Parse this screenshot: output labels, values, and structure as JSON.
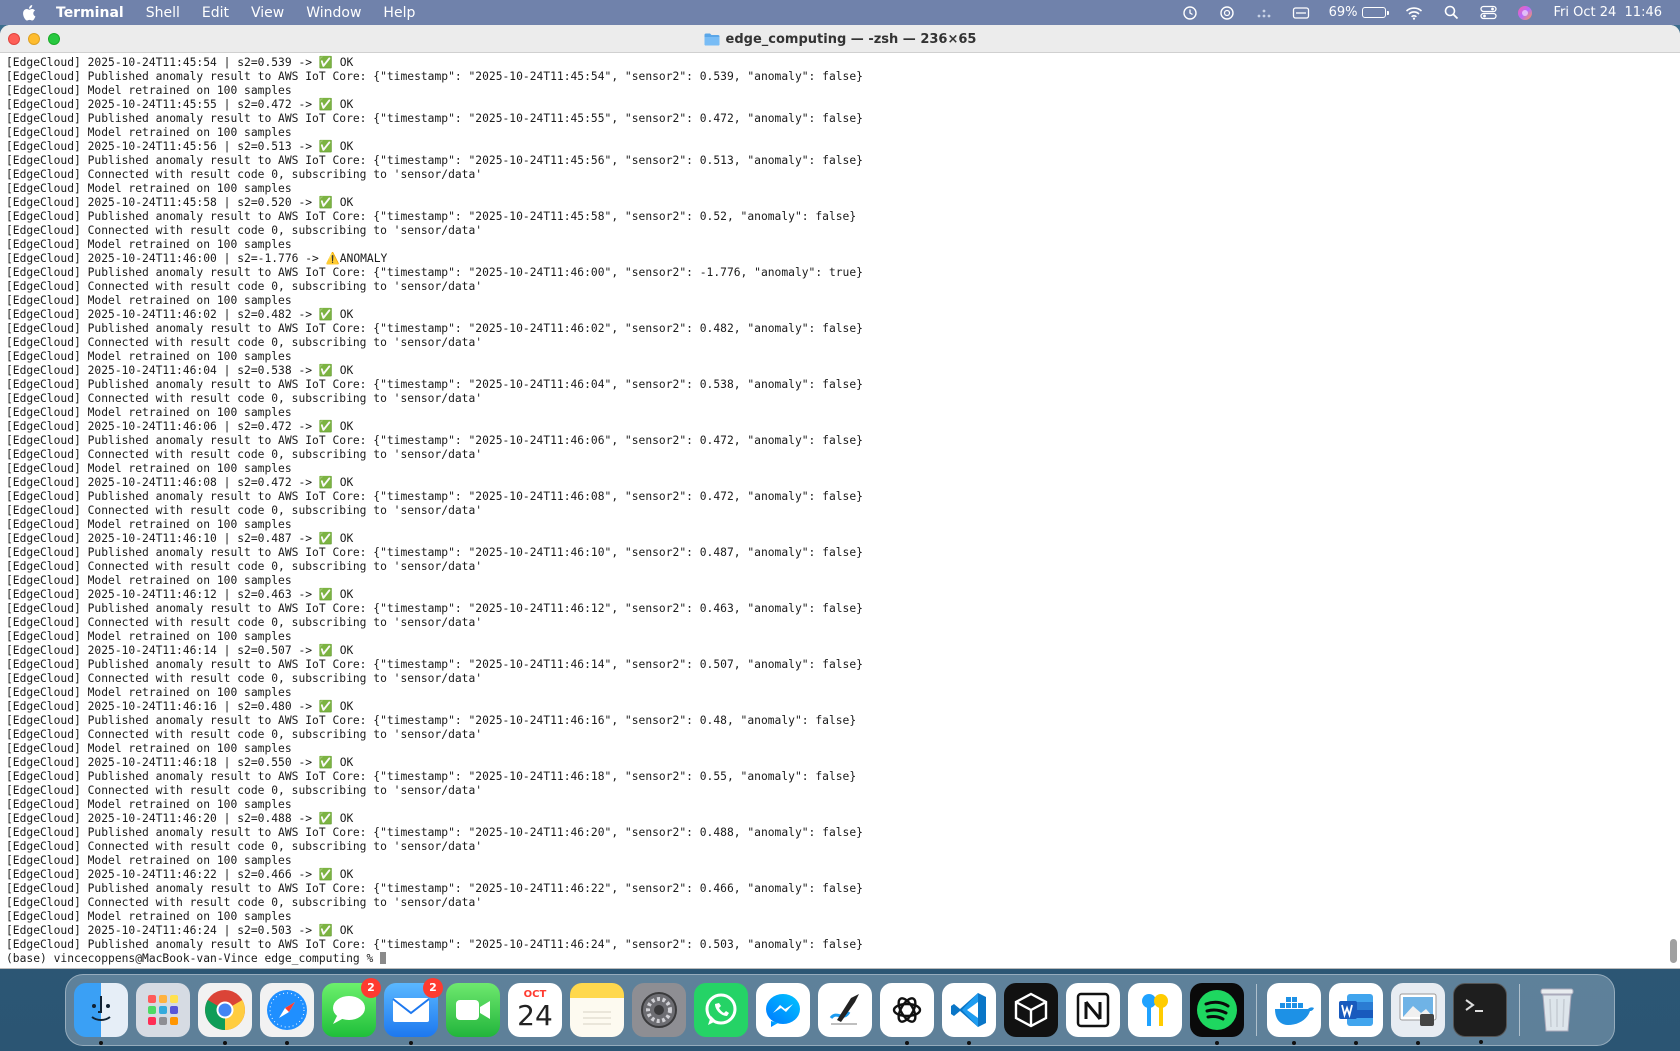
{
  "menubar": {
    "app_name": "Terminal",
    "items": [
      "Shell",
      "Edit",
      "View",
      "Window",
      "Help"
    ],
    "battery_percent": "69%",
    "battery_level": 0.69,
    "datetime": "Fri Oct 24  11:46"
  },
  "window": {
    "title": "edge_computing — -zsh — 236×65"
  },
  "terminal": {
    "lines": [
      "[EdgeCloud] 2025-10-24T11:45:54 | s2=0.539 -> ✅ OK",
      "[EdgeCloud] Published anomaly result to AWS IoT Core: {\"timestamp\": \"2025-10-24T11:45:54\", \"sensor2\": 0.539, \"anomaly\": false}",
      "[EdgeCloud] Model retrained on 100 samples",
      "[EdgeCloud] 2025-10-24T11:45:55 | s2=0.472 -> ✅ OK",
      "[EdgeCloud] Published anomaly result to AWS IoT Core: {\"timestamp\": \"2025-10-24T11:45:55\", \"sensor2\": 0.472, \"anomaly\": false}",
      "[EdgeCloud] Model retrained on 100 samples",
      "[EdgeCloud] 2025-10-24T11:45:56 | s2=0.513 -> ✅ OK",
      "[EdgeCloud] Published anomaly result to AWS IoT Core: {\"timestamp\": \"2025-10-24T11:45:56\", \"sensor2\": 0.513, \"anomaly\": false}",
      "[EdgeCloud] Connected with result code 0, subscribing to 'sensor/data'",
      "[EdgeCloud] Model retrained on 100 samples",
      "[EdgeCloud] 2025-10-24T11:45:58 | s2=0.520 -> ✅ OK",
      "[EdgeCloud] Published anomaly result to AWS IoT Core: {\"timestamp\": \"2025-10-24T11:45:58\", \"sensor2\": 0.52, \"anomaly\": false}",
      "[EdgeCloud] Connected with result code 0, subscribing to 'sensor/data'",
      "[EdgeCloud] Model retrained on 100 samples",
      "[EdgeCloud] 2025-10-24T11:46:00 | s2=-1.776 -> ⚠️ANOMALY",
      "[EdgeCloud] Published anomaly result to AWS IoT Core: {\"timestamp\": \"2025-10-24T11:46:00\", \"sensor2\": -1.776, \"anomaly\": true}",
      "[EdgeCloud] Connected with result code 0, subscribing to 'sensor/data'",
      "[EdgeCloud] Model retrained on 100 samples",
      "[EdgeCloud] 2025-10-24T11:46:02 | s2=0.482 -> ✅ OK",
      "[EdgeCloud] Published anomaly result to AWS IoT Core: {\"timestamp\": \"2025-10-24T11:46:02\", \"sensor2\": 0.482, \"anomaly\": false}",
      "[EdgeCloud] Connected with result code 0, subscribing to 'sensor/data'",
      "[EdgeCloud] Model retrained on 100 samples",
      "[EdgeCloud] 2025-10-24T11:46:04 | s2=0.538 -> ✅ OK",
      "[EdgeCloud] Published anomaly result to AWS IoT Core: {\"timestamp\": \"2025-10-24T11:46:04\", \"sensor2\": 0.538, \"anomaly\": false}",
      "[EdgeCloud] Connected with result code 0, subscribing to 'sensor/data'",
      "[EdgeCloud] Model retrained on 100 samples",
      "[EdgeCloud] 2025-10-24T11:46:06 | s2=0.472 -> ✅ OK",
      "[EdgeCloud] Published anomaly result to AWS IoT Core: {\"timestamp\": \"2025-10-24T11:46:06\", \"sensor2\": 0.472, \"anomaly\": false}",
      "[EdgeCloud] Connected with result code 0, subscribing to 'sensor/data'",
      "[EdgeCloud] Model retrained on 100 samples",
      "[EdgeCloud] 2025-10-24T11:46:08 | s2=0.472 -> ✅ OK",
      "[EdgeCloud] Published anomaly result to AWS IoT Core: {\"timestamp\": \"2025-10-24T11:46:08\", \"sensor2\": 0.472, \"anomaly\": false}",
      "[EdgeCloud] Connected with result code 0, subscribing to 'sensor/data'",
      "[EdgeCloud] Model retrained on 100 samples",
      "[EdgeCloud] 2025-10-24T11:46:10 | s2=0.487 -> ✅ OK",
      "[EdgeCloud] Published anomaly result to AWS IoT Core: {\"timestamp\": \"2025-10-24T11:46:10\", \"sensor2\": 0.487, \"anomaly\": false}",
      "[EdgeCloud] Connected with result code 0, subscribing to 'sensor/data'",
      "[EdgeCloud] Model retrained on 100 samples",
      "[EdgeCloud] 2025-10-24T11:46:12 | s2=0.463 -> ✅ OK",
      "[EdgeCloud] Published anomaly result to AWS IoT Core: {\"timestamp\": \"2025-10-24T11:46:12\", \"sensor2\": 0.463, \"anomaly\": false}",
      "[EdgeCloud] Connected with result code 0, subscribing to 'sensor/data'",
      "[EdgeCloud] Model retrained on 100 samples",
      "[EdgeCloud] 2025-10-24T11:46:14 | s2=0.507 -> ✅ OK",
      "[EdgeCloud] Published anomaly result to AWS IoT Core: {\"timestamp\": \"2025-10-24T11:46:14\", \"sensor2\": 0.507, \"anomaly\": false}",
      "[EdgeCloud] Connected with result code 0, subscribing to 'sensor/data'",
      "[EdgeCloud] Model retrained on 100 samples",
      "[EdgeCloud] 2025-10-24T11:46:16 | s2=0.480 -> ✅ OK",
      "[EdgeCloud] Published anomaly result to AWS IoT Core: {\"timestamp\": \"2025-10-24T11:46:16\", \"sensor2\": 0.48, \"anomaly\": false}",
      "[EdgeCloud] Connected with result code 0, subscribing to 'sensor/data'",
      "[EdgeCloud] Model retrained on 100 samples",
      "[EdgeCloud] 2025-10-24T11:46:18 | s2=0.550 -> ✅ OK",
      "[EdgeCloud] Published anomaly result to AWS IoT Core: {\"timestamp\": \"2025-10-24T11:46:18\", \"sensor2\": 0.55, \"anomaly\": false}",
      "[EdgeCloud] Connected with result code 0, subscribing to 'sensor/data'",
      "[EdgeCloud] Model retrained on 100 samples",
      "[EdgeCloud] 2025-10-24T11:46:20 | s2=0.488 -> ✅ OK",
      "[EdgeCloud] Published anomaly result to AWS IoT Core: {\"timestamp\": \"2025-10-24T11:46:20\", \"sensor2\": 0.488, \"anomaly\": false}",
      "[EdgeCloud] Connected with result code 0, subscribing to 'sensor/data'",
      "[EdgeCloud] Model retrained on 100 samples",
      "[EdgeCloud] 2025-10-24T11:46:22 | s2=0.466 -> ✅ OK",
      "[EdgeCloud] Published anomaly result to AWS IoT Core: {\"timestamp\": \"2025-10-24T11:46:22\", \"sensor2\": 0.466, \"anomaly\": false}",
      "[EdgeCloud] Connected with result code 0, subscribing to 'sensor/data'",
      "[EdgeCloud] Model retrained on 100 samples",
      "[EdgeCloud] 2025-10-24T11:46:24 | s2=0.503 -> ✅ OK",
      "[EdgeCloud] Published anomaly result to AWS IoT Core: {\"timestamp\": \"2025-10-24T11:46:24\", \"sensor2\": 0.503, \"anomaly\": false}"
    ],
    "prompt": "(base) vincecoppens@MacBook-van-Vince edge_computing % "
  },
  "dock": {
    "messages_badge": "2",
    "mail_badge": "2",
    "calendar_month": "OCT",
    "calendar_day": "24"
  },
  "colors": {
    "menubar": "#7082ab",
    "close": "#fe5f57",
    "minimize": "#febc2e",
    "maximize": "#28c840"
  }
}
